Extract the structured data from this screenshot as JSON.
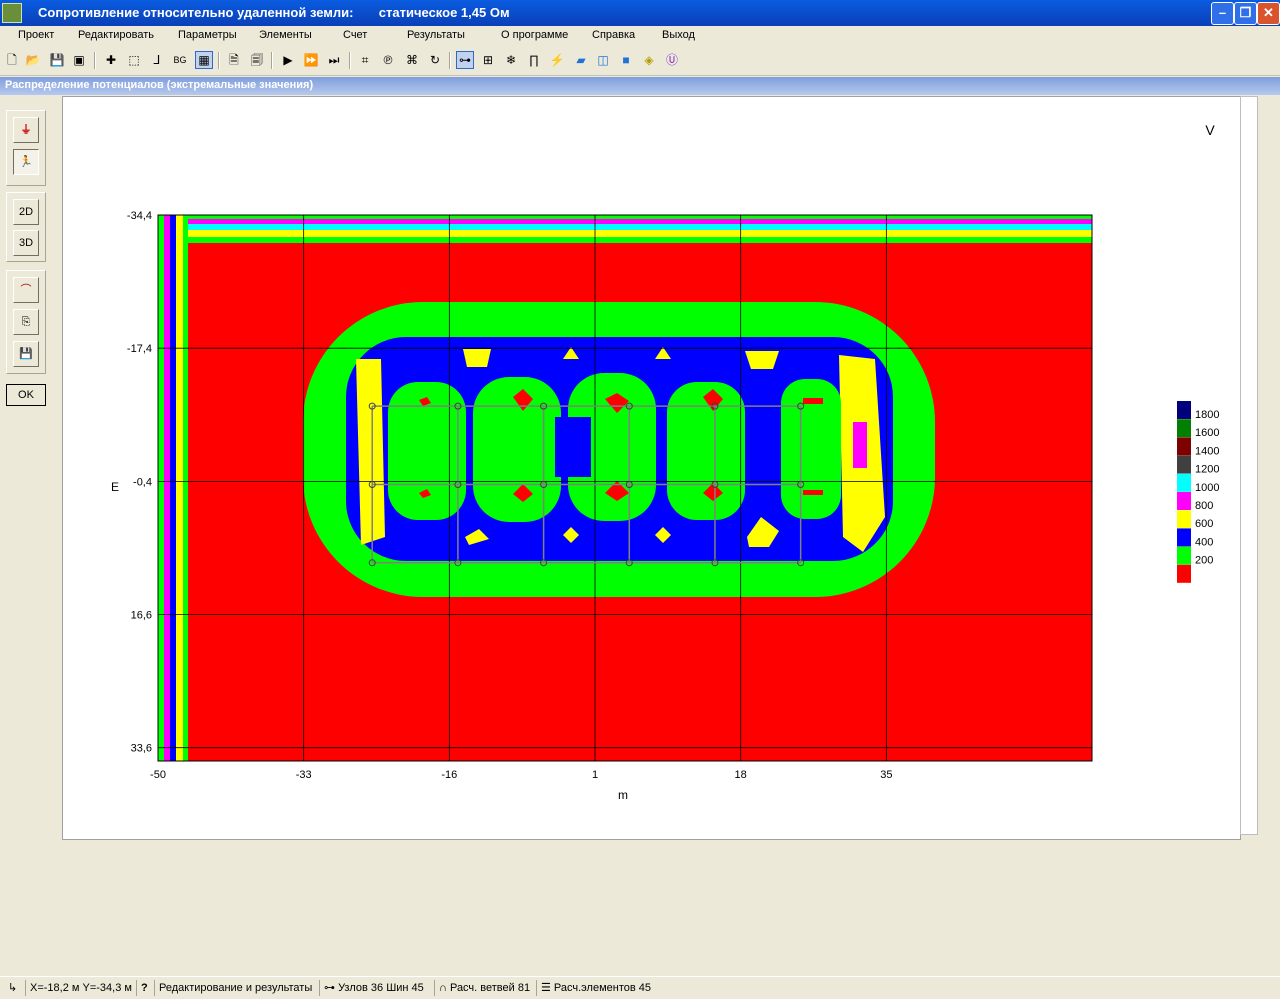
{
  "window": {
    "title": "Сопротивление относительно удаленной земли:       статическое 1,45 Ом"
  },
  "menu": [
    "Проект",
    "Редактировать",
    "Параметры",
    "Элементы",
    "Счет",
    "Результаты",
    "О программе",
    "Справка",
    "Выход"
  ],
  "child_window": {
    "title": "Распределение потенциалов (экстремальные значения)"
  },
  "left_panel": {
    "btn_2d": "2D",
    "btn_3d": "3D",
    "ok": "OK"
  },
  "toolbar_icons": [
    "new-file-icon",
    "open-folder-icon",
    "save-icon",
    "save-all-icon",
    "add-node-icon",
    "select-frame-icon",
    "axis-icon",
    "bg-icon",
    "grid-icon",
    "report-icon",
    "report-view-icon",
    "run-icon",
    "run-fast-icon",
    "run-all-icon",
    "branch-edit-icon",
    "branch-params-icon",
    "branch-frame-icon",
    "branch-loop-icon",
    "link-icon",
    "mesh-icon",
    "snowflake-icon",
    "magnet-icon",
    "rod-icon",
    "plane-icon",
    "box-icon",
    "cube-icon",
    "diamond-icon",
    "circle-u-icon"
  ],
  "chart_data": {
    "type": "heatmap",
    "unit_label": "V",
    "xlabel": "m",
    "ylabel": "E",
    "x_ticks": [
      "-50",
      "-33",
      "-16",
      "1",
      "18",
      "35"
    ],
    "y_ticks": [
      "-34,4",
      "-17,4",
      "-0,4",
      "16,6",
      "33,6"
    ],
    "legend": [
      {
        "value": "1800",
        "color": "#00007f"
      },
      {
        "value": "1600",
        "color": "#007f00"
      },
      {
        "value": "1400",
        "color": "#7f0000"
      },
      {
        "value": "1200",
        "color": "#404040"
      },
      {
        "value": "1000",
        "color": "#00ffff"
      },
      {
        "value": "800",
        "color": "#ff00ff"
      },
      {
        "value": "600",
        "color": "#ffff00"
      },
      {
        "value": "400",
        "color": "#0000ff"
      },
      {
        "value": "200",
        "color": "#00ff00"
      },
      {
        "value": "",
        "color": "#ff0000"
      }
    ],
    "grid_nodes": {
      "x": [
        -25,
        -15,
        -5,
        5,
        15,
        25
      ],
      "y": [
        -10,
        0,
        10
      ]
    },
    "grid": true
  },
  "status": {
    "coords": "X=-18,2 м  Y=-34,3 м",
    "help": "?",
    "mode": "Редактирование и результаты",
    "nodes": "Узлов 36 Шин 45",
    "branches": "Расч. ветвей 81",
    "elements": "Расч.элементов 45"
  }
}
